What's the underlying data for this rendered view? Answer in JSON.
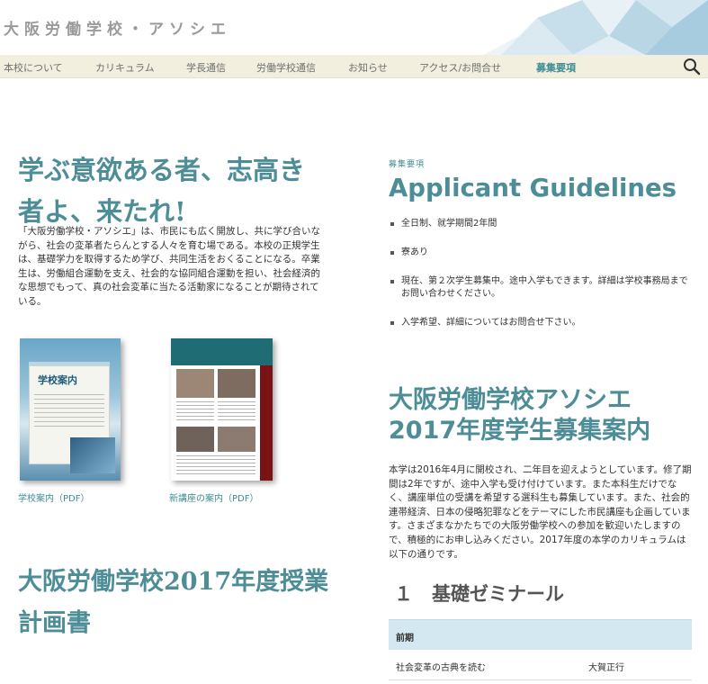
{
  "site": {
    "title": "大阪労働学校・アソシエ"
  },
  "nav": {
    "items": [
      "本校について",
      "カリキュラム",
      "学長通信",
      "労働学校通信",
      "お知らせ",
      "アクセス/お問合せ",
      "募集要項"
    ],
    "active": "募集要項",
    "search_icon": "search-icon"
  },
  "hero": {
    "title": "学ぶ意欲ある者、志高き者よ、来たれ!",
    "intro": "「大阪労働学校・アソシエ」は、市民にも広く開放し、共に学び合いながら、社会の変革者たらんとする人々を育む場である。本校の正規学生は、基礎学力を取得するため学び、共同生活をおくることになる。卒業生は、労働組合運動を支え、社会的な協同組合運動を担い、社会経済的な思想でもって、真の社会変革に当たる活動家になることが期待されている。"
  },
  "brochures": [
    {
      "title": "学校案内",
      "link": "学校案内（PDF）"
    },
    {
      "link": "新講座の案内（PDF）"
    }
  ],
  "plan": {
    "title": "大阪労働学校2017年度授業計画書"
  },
  "guidelines": {
    "kicker": "募集要項",
    "title": "Applicant Guidelines",
    "items": [
      "全日制、就学期間2年間",
      "寮あり",
      "現在、第２次学生募集中。途中入学もできます。詳細は学校事務局までお問い合わせください。",
      "入学希望、詳細についてはお問合せ下さい。"
    ]
  },
  "recruit": {
    "title": "大阪労働学校アソシエ2017年度学生募集案内",
    "text": "本学は2016年4月に開校され、二年目を迎えようとしています。修了期間は2年ですが、途中入学も受け付けています。また本科生だけでなく、講座単位の受講を希望する選科生も募集しています。また、社会的連帯経済、日本の侵略犯罪などをテーマにした市民講座も企画しています。さまざまなかたちでの大阪労働学校への参加を歓迎いたしますので、積極的にお申し込みください。2017年度の本学のカリキュラムは以下の通りです。"
  },
  "seminar": {
    "title": "１　基礎ゼミナール",
    "header": "前期",
    "rows": [
      {
        "course": "社会変革の古典を読む",
        "teacher": "大賀正行"
      }
    ]
  }
}
